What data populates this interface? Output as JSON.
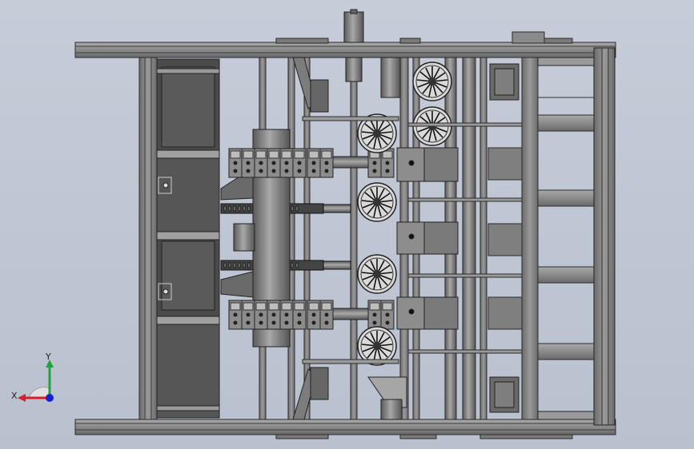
{
  "viewport": {
    "background_top": "#c6ccd8",
    "background_bottom": "#b9c1cf",
    "model_stroke": "#2e2e2e",
    "model_fill": "#8e8e8e",
    "model_fill_light": "#b0b0b0",
    "model_fill_dark": "#5e5e5e"
  },
  "triad": {
    "x_label": "X",
    "y_label": "Y",
    "x_color": "#d2202a",
    "y_color": "#1fa43a",
    "z_color": "#1a1fd0"
  },
  "icons": {
    "triad": "coordinate-triad-icon",
    "fan": "fan-wheel-icon"
  }
}
